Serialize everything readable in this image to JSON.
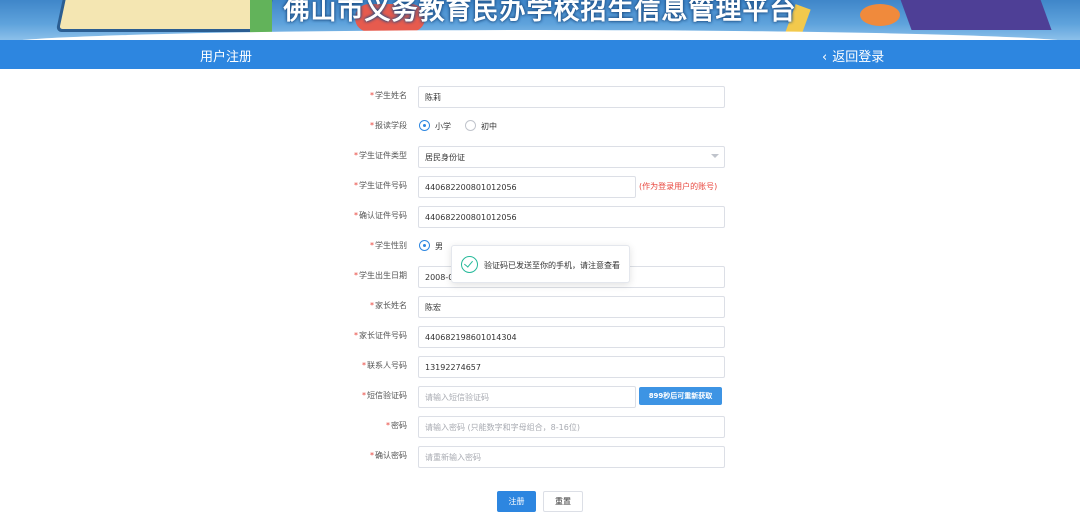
{
  "banner": {
    "title": "佛山市义务教育民办学校招生信息管理平台"
  },
  "navbar": {
    "page_title": "用户注册",
    "back_label": "返回登录",
    "back_icon": "chevron-left-icon"
  },
  "form": {
    "required_mark": "*",
    "student_name": {
      "label": "学生姓名",
      "value": "陈莉"
    },
    "school_level": {
      "label": "报读学段",
      "options": [
        "小学",
        "初中"
      ],
      "selected": "小学"
    },
    "id_type": {
      "label": "学生证件类型",
      "value": "居民身份证"
    },
    "id_number": {
      "label": "学生证件号码",
      "value": "440682200801012056",
      "hint": "(作为登录用户的账号)"
    },
    "confirm_id": {
      "label": "确认证件号码",
      "value": "440682200801012056"
    },
    "gender": {
      "label": "学生性别",
      "options": [
        "男"
      ],
      "selected": "男"
    },
    "birth_date": {
      "label": "学生出生日期",
      "value": "2008-0"
    },
    "parent_name": {
      "label": "家长姓名",
      "value": "陈宏"
    },
    "parent_id": {
      "label": "家长证件号码",
      "value": "440682198601014304"
    },
    "phone": {
      "label": "联系人号码",
      "value": "13192274657"
    },
    "sms_code": {
      "label": "短信验证码",
      "placeholder": "请输入短信验证码",
      "button": "899秒后可重新获取"
    },
    "password": {
      "label": "密码",
      "placeholder": "请输入密码 (只能数字和字母组合，8-16位)"
    },
    "confirm_password": {
      "label": "确认密码",
      "placeholder": "请重新输入密码"
    }
  },
  "toast": {
    "message": "验证码已发送至你的手机，请注意查看",
    "icon": "check-circle-icon"
  },
  "actions": {
    "register": "注册",
    "reset": "重置"
  },
  "colors": {
    "primary": "#2d86e0",
    "required": "#e8453c",
    "success": "#26b99a"
  }
}
